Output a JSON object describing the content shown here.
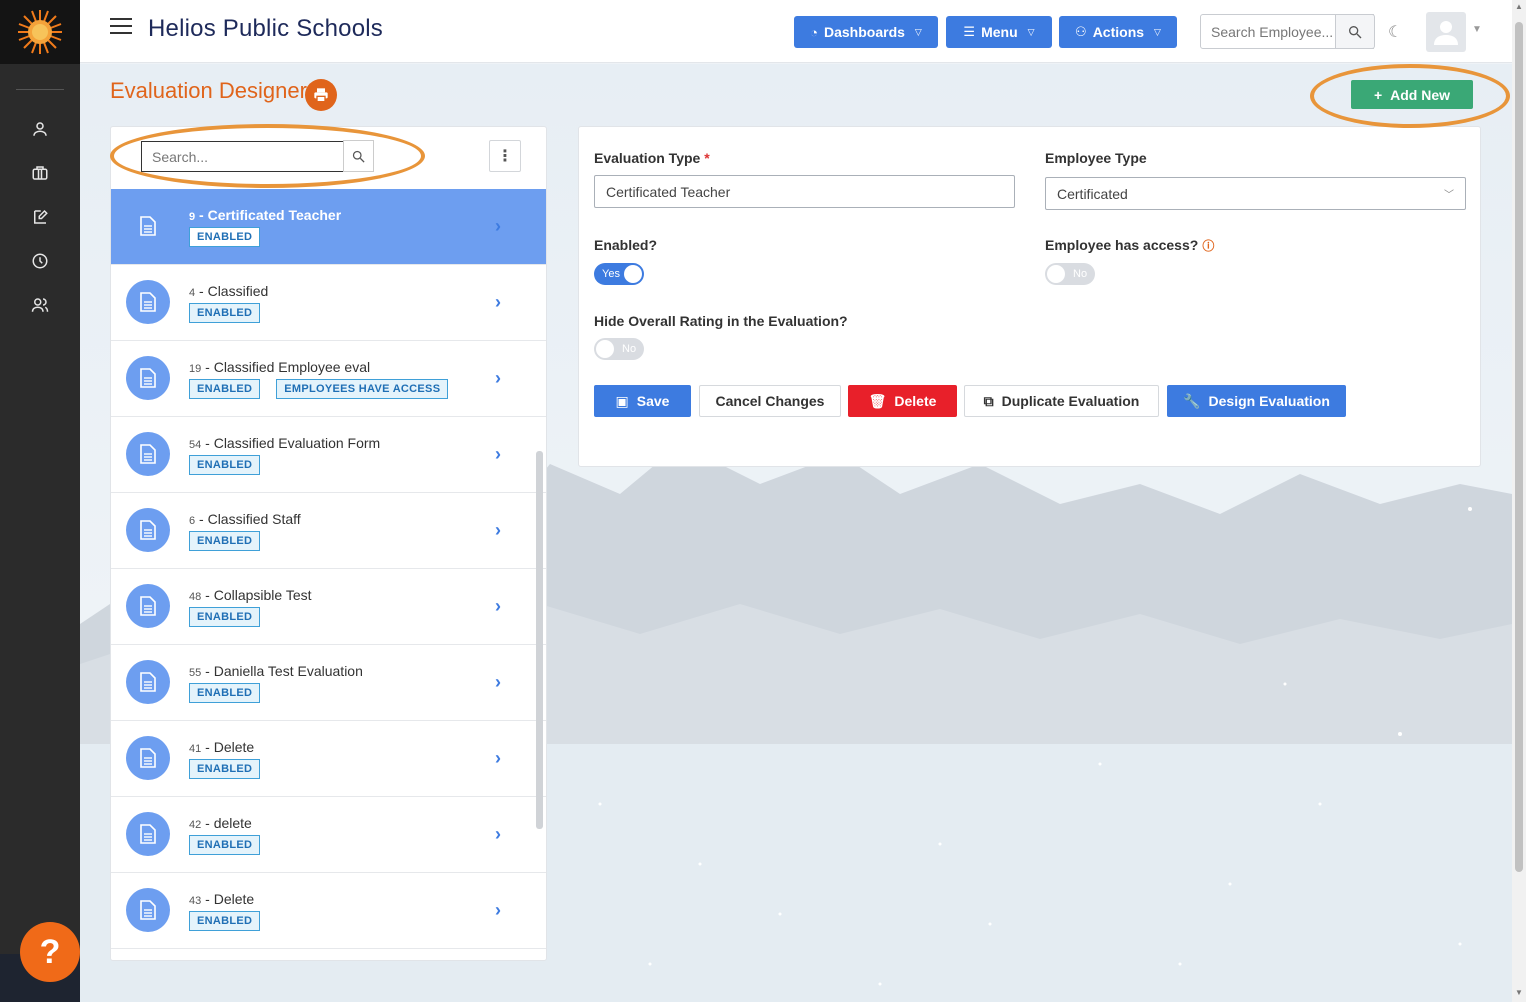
{
  "header": {
    "school_name": "Helios Public Schools",
    "dashboards_label": "Dashboards",
    "menu_label": "Menu",
    "actions_label": "Actions",
    "search_placeholder": "Search Employee..."
  },
  "page": {
    "title": "Evaluation Designer",
    "add_new_label": "Add New"
  },
  "list": {
    "search_placeholder": "Search...",
    "items": [
      {
        "num": "9",
        "title": "Certificated Teacher",
        "badges": [
          "ENABLED"
        ],
        "active": true
      },
      {
        "num": "4",
        "title": "Classified",
        "badges": [
          "ENABLED"
        ]
      },
      {
        "num": "19",
        "title": "Classified Employee eval",
        "badges": [
          "ENABLED",
          "EMPLOYEES HAVE ACCESS"
        ]
      },
      {
        "num": "54",
        "title": "Classified Evaluation Form",
        "badges": [
          "ENABLED"
        ]
      },
      {
        "num": "6",
        "title": "Classified Staff",
        "badges": [
          "ENABLED"
        ]
      },
      {
        "num": "48",
        "title": "Collapsible Test",
        "badges": [
          "ENABLED"
        ]
      },
      {
        "num": "55",
        "title": "Daniella Test Evaluation",
        "badges": [
          "ENABLED"
        ]
      },
      {
        "num": "41",
        "title": "Delete",
        "badges": [
          "ENABLED"
        ]
      },
      {
        "num": "42",
        "title": "delete",
        "badges": [
          "ENABLED"
        ]
      },
      {
        "num": "43",
        "title": "Delete",
        "badges": [
          "ENABLED"
        ]
      }
    ]
  },
  "form": {
    "eval_type_label": "Evaluation Type",
    "eval_type_required": "*",
    "eval_type_value": "Certificated Teacher",
    "emp_type_label": "Employee Type",
    "emp_type_value": "Certificated",
    "enabled_label": "Enabled?",
    "enabled_value": "Yes",
    "access_label": "Employee has access?",
    "access_value": "No",
    "hide_rating_label": "Hide Overall Rating in the Evaluation?",
    "hide_rating_value": "No",
    "save_label": "Save",
    "cancel_label": "Cancel Changes",
    "delete_label": "Delete",
    "duplicate_label": "Duplicate Evaluation",
    "design_label": "Design Evaluation"
  },
  "colors": {
    "accent_blue": "#3d7be0",
    "title_orange": "#e0641b",
    "add_green": "#3aa876",
    "danger_red": "#e8202a",
    "annotation_orange": "#e8953a"
  },
  "help": {
    "glyph": "?"
  }
}
